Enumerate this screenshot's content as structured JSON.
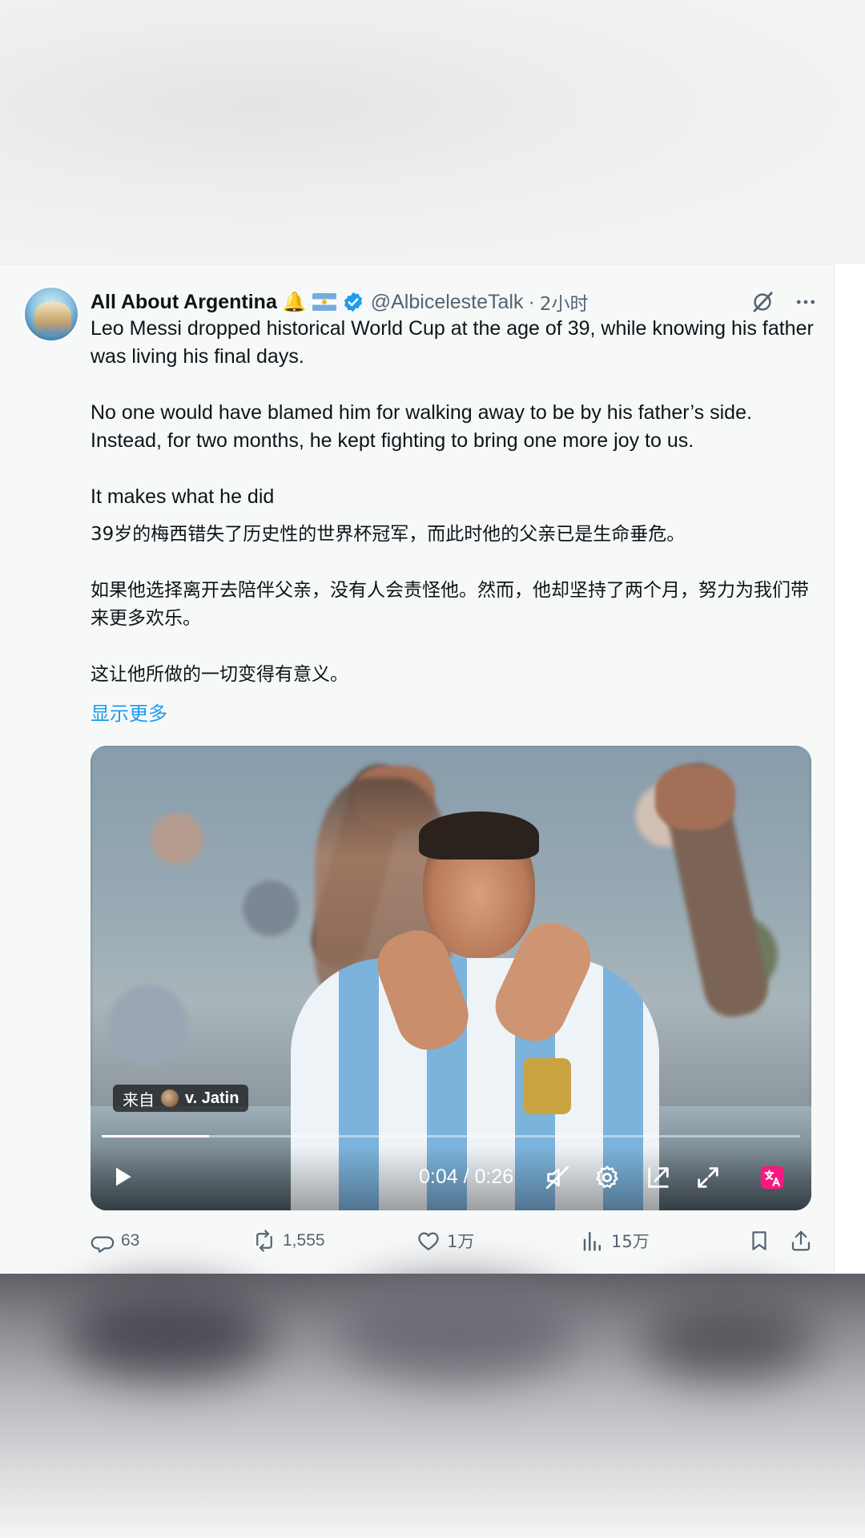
{
  "tweet": {
    "author_name": "All About Argentina",
    "author_handle": "@AlbicelesteTalk",
    "separator": "·",
    "time_ago": "2小时",
    "body_en": [
      "Leo Messi dropped historical World Cup at the age of 39, while knowing his father was living his final days.",
      "No one would have blamed him for walking away to be by his father’s side. Instead, for two months, he kept fighting to bring one more joy to us.",
      "It makes what he did"
    ],
    "body_zh": [
      "39岁的梅西错失了历史性的世界杯冠军，而此时他的父亲已是生命垂危。",
      "如果他选择离开去陪伴父亲，没有人会责怪他。然而，他却坚持了两个月，努力为我们带来更多欢乐。",
      "这让他所做的一切变得有意义。"
    ],
    "show_more_label": "显示更多"
  },
  "video": {
    "source_label": "来自",
    "source_name": "v. Jatin",
    "current_time": "0:04",
    "duration": "0:26",
    "time_display": "0:04 / 0:26",
    "progress_fraction": 0.154
  },
  "actions": {
    "replies": "63",
    "reposts": "1,555",
    "likes": "1万",
    "views": "15万"
  },
  "colors": {
    "accent": "#1d9bf0",
    "verified": "#1d9bf0",
    "text_primary": "#0f1419",
    "text_secondary": "#536471",
    "translate_badge": "#f91880"
  },
  "icons": {
    "verified": "verified-badge-icon",
    "grok": "grok-icon",
    "more": "more-icon",
    "play": "play-icon",
    "mute": "volume-muted-icon",
    "settings": "gear-icon",
    "pip": "picture-in-picture-icon",
    "fullscreen": "fullscreen-icon",
    "translate": "translate-icon",
    "reply": "reply-icon",
    "repost": "repost-icon",
    "like": "heart-icon",
    "views": "views-chart-icon",
    "bookmark": "bookmark-icon",
    "share": "share-icon"
  }
}
